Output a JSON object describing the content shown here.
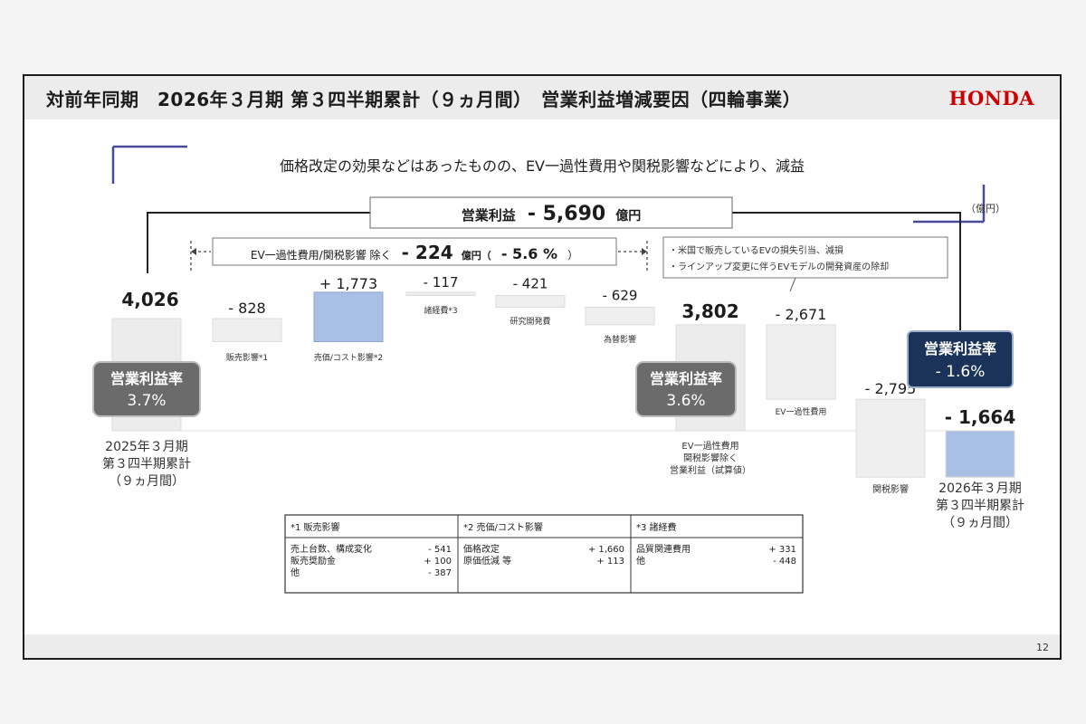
{
  "header": {
    "title": "対前年同期　2026年３月期 第３四半期累計（９ヵ月間）　営業利益増減要因（四輪事業）",
    "logo": "HONDA"
  },
  "page_number": "12",
  "subtitle": "価格改定の効果などはあったものの、EV一過性費用や関税影響などにより、減益",
  "summary": {
    "label": "営業利益",
    "value": "- 5,690",
    "unit": "億円",
    "sub_label": "EV一過性費用/関税影響 除く",
    "sub_value": "- 224",
    "sub_unit": "億円（",
    "sub_pct": "- 5.6 %",
    "sub_close": "）"
  },
  "unit_label": "（億円）",
  "note_box": [
    "・米国で販売しているEVの損失引当、減損",
    "・ラインアップ変更に伴うEVモデルの開発資産の除却"
  ],
  "margins": [
    {
      "label": "営業利益率",
      "value": "3.7%"
    },
    {
      "label": "営業利益率",
      "value": "3.6%"
    },
    {
      "label": "営業利益率",
      "value": "- 1.6%"
    }
  ],
  "chart_data": {
    "type": "bar",
    "subtype": "waterfall",
    "unit": "億円",
    "categories": [
      "2025年３月期\n第３四半期累計\n（９ヵ月間）",
      "販売影響*1",
      "売価/コスト影響*2",
      "諸経費*3",
      "研究開発費",
      "為替影響",
      "EV一過性費用\n関税影響除く\n営業利益（試算値）",
      "EV一過性費用",
      "関税影響",
      "2026年３月期\n第３四半期累計\n（９ヵ月間）"
    ],
    "values": [
      4026,
      -828,
      1773,
      -117,
      -421,
      -629,
      3802,
      -2671,
      -2795,
      -1664
    ],
    "value_labels": [
      "4,026",
      "- 828",
      "+ 1,773",
      "- 117",
      "- 421",
      "- 629",
      "3,802",
      "- 2,671",
      "- 2,795",
      "- 1,664"
    ],
    "bar_kind": [
      "total",
      "delta",
      "delta",
      "delta",
      "delta",
      "delta",
      "total",
      "delta",
      "delta",
      "total"
    ],
    "colors": {
      "total": "#ececec",
      "decrease": "#efefef",
      "increase": "#a9bfe3",
      "final_total": "#a9bfe3",
      "margin_box": "#6b6b6b",
      "margin_box_final": "#1b3358",
      "accent_line": "#4a4a9a"
    }
  },
  "breakdown_table": {
    "columns": [
      {
        "header": "*1 販売影響",
        "rows": [
          [
            "売上台数、構成変化",
            "- 541"
          ],
          [
            "販売奨励金",
            "+ 100"
          ],
          [
            "他",
            "- 387"
          ]
        ]
      },
      {
        "header": "*2 売価/コスト影響",
        "rows": [
          [
            "価格改定",
            "+ 1,660"
          ],
          [
            "原価低減 等",
            "+ 113"
          ]
        ]
      },
      {
        "header": "*3 諸経費",
        "rows": [
          [
            "品質関連費用",
            "+ 331"
          ],
          [
            "他",
            "- 448"
          ]
        ]
      }
    ]
  }
}
